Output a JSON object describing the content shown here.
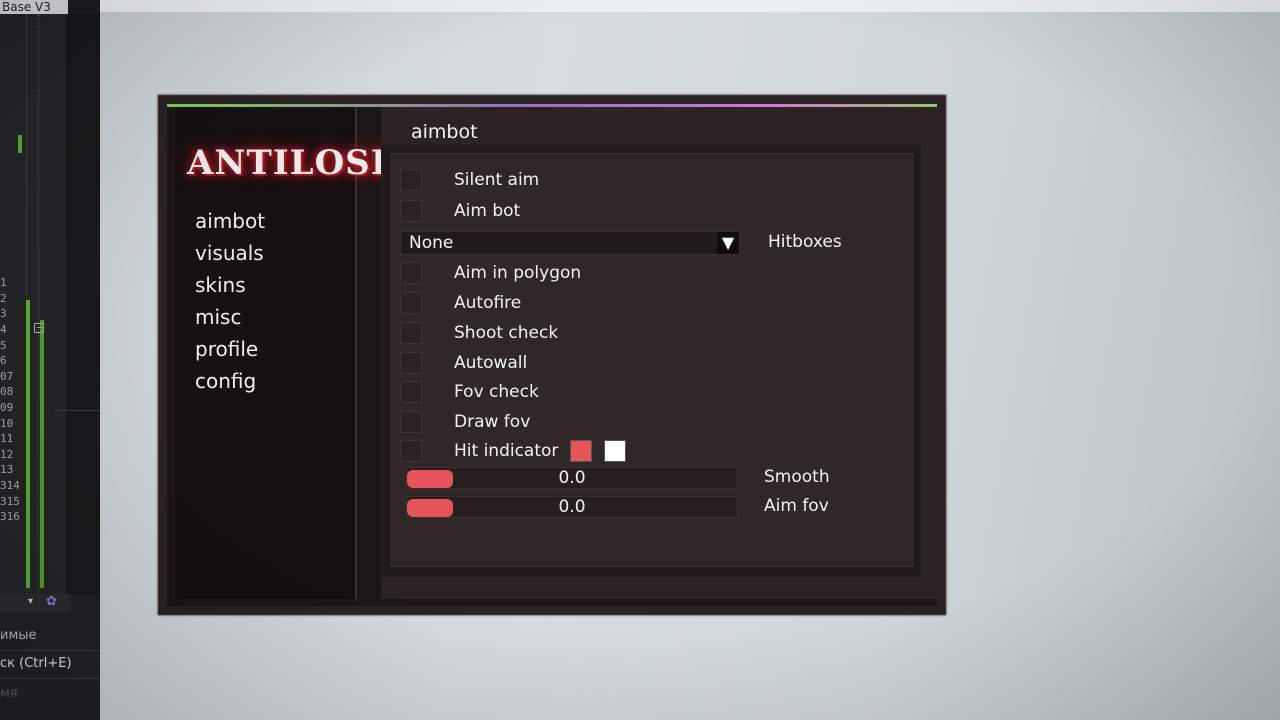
{
  "background_app": {
    "title": "Base V3",
    "line_numbers": [
      "",
      "",
      "1",
      "2",
      "3",
      "4",
      "5",
      "6",
      "07",
      "08",
      "09",
      "10",
      "11",
      "12",
      "13",
      "314",
      "315",
      "316"
    ],
    "bottom_items": [
      "имые",
      "ск (Ctrl+E)",
      "мя"
    ]
  },
  "menu": {
    "logo": "ANTILOSE",
    "nav": [
      "aimbot",
      "visuals",
      "skins",
      "misc",
      "profile",
      "config"
    ],
    "section_title": "aimbot",
    "options": {
      "silent_aim": "Silent aim",
      "aim_bot": "Aim bot",
      "hitboxes_value": "None",
      "hitboxes_label": "Hitboxes",
      "aim_in_polygon": "Aim in polygon",
      "autofire": "Autofire",
      "shoot_check": "Shoot check",
      "autowall": "Autowall",
      "fov_check": "Fov check",
      "draw_fov": "Draw fov",
      "hit_indicator": "Hit indicator"
    },
    "sliders": {
      "smooth_value": "0.0",
      "smooth_label": "Smooth",
      "aim_fov_value": "0.0",
      "aim_fov_label": "Aim fov"
    },
    "colors": {
      "accent": "#e65358",
      "hit_color_1": "#e65358",
      "hit_color_2": "#ffffff"
    },
    "icons": {
      "dropdown": "triangle-down-icon"
    }
  }
}
